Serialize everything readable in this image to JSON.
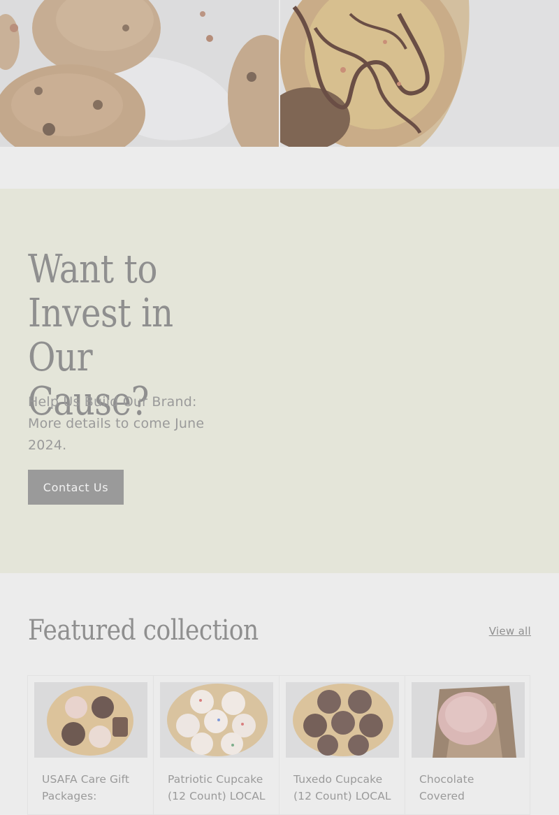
{
  "invest": {
    "title": "Want to Invest in Our Cause?",
    "text": "Help Us Build Our Brand: More details to come June 2024.",
    "button_label": "Contact Us"
  },
  "featured": {
    "title": "Featured collection",
    "view_all_label": "View all",
    "products": [
      {
        "title": "USAFA Care Gift Packages:"
      },
      {
        "title": "Patriotic Cupcake (12 Count) LOCAL"
      },
      {
        "title": "Tuxedo Cupcake (12 Count) LOCAL"
      },
      {
        "title": "Chocolate Covered"
      }
    ]
  },
  "colors": {
    "invest_bg": "#e4e5d9",
    "page_bg": "#ececec",
    "button_bg": "#9a9a9a",
    "heading": "#8f8f8f"
  }
}
